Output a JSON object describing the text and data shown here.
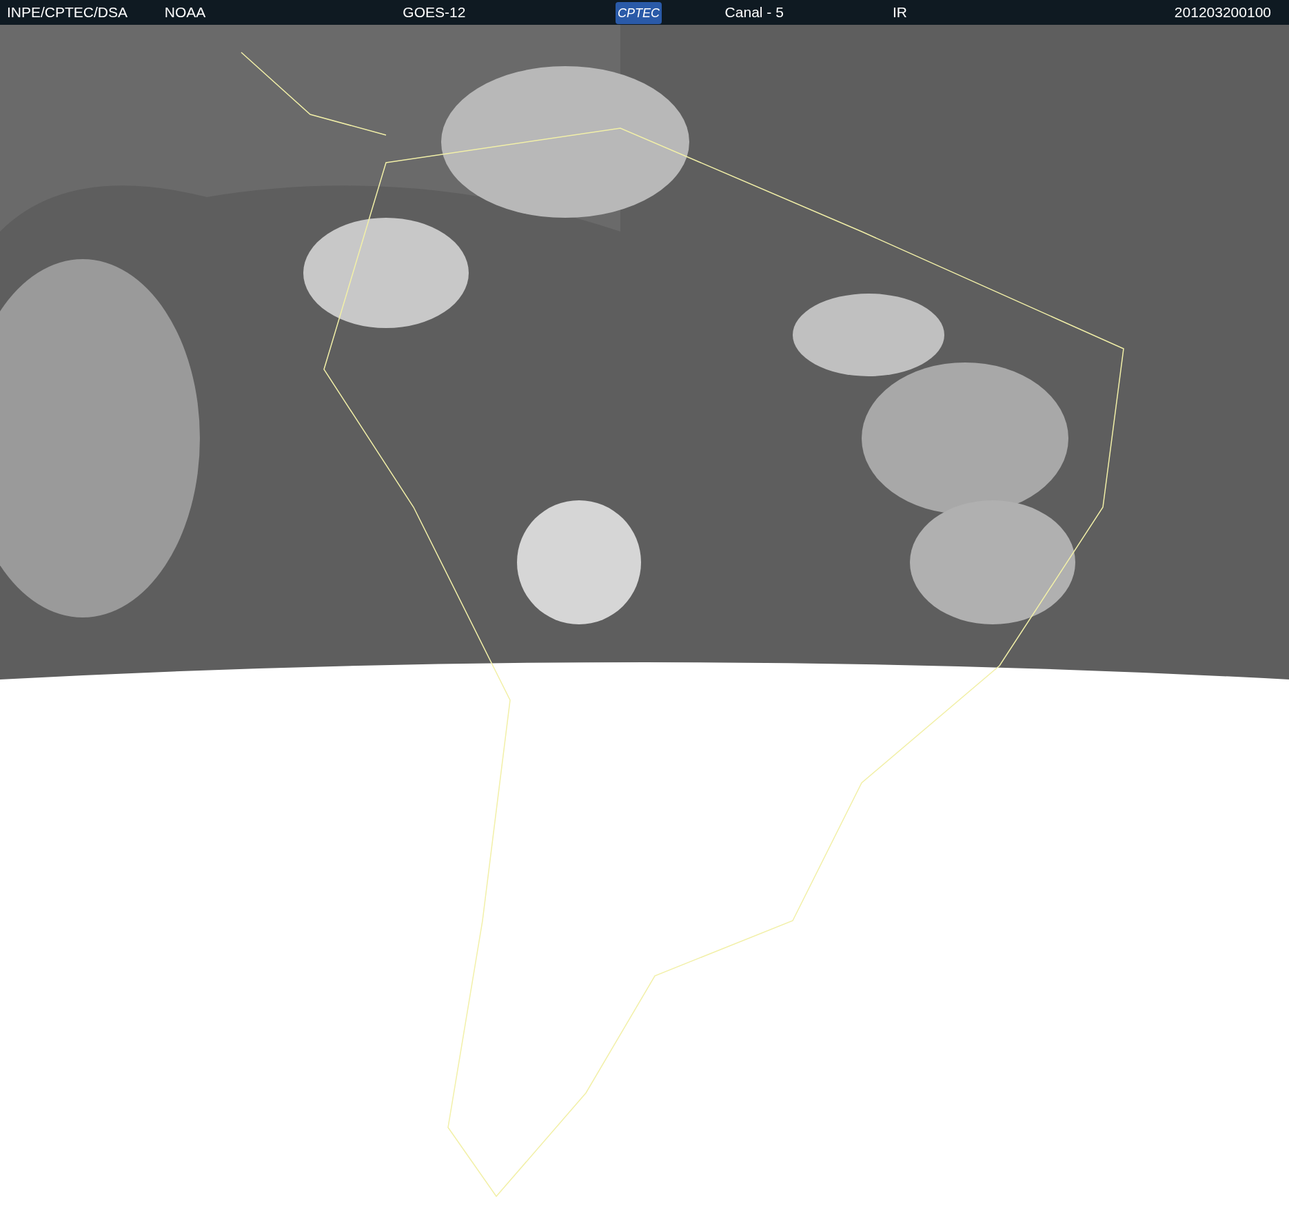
{
  "header": {
    "items": [
      {
        "kind": "text",
        "text": "INPE/CPTEC/DSA"
      },
      {
        "kind": "text",
        "text": "NOAA"
      },
      {
        "kind": "text",
        "text": "GOES-12"
      },
      {
        "kind": "logo",
        "text": "CPTEC"
      },
      {
        "kind": "text",
        "text": "Canal - 5"
      },
      {
        "kind": "text",
        "text": "IR"
      },
      {
        "kind": "text",
        "text": "201203200100"
      }
    ]
  }
}
